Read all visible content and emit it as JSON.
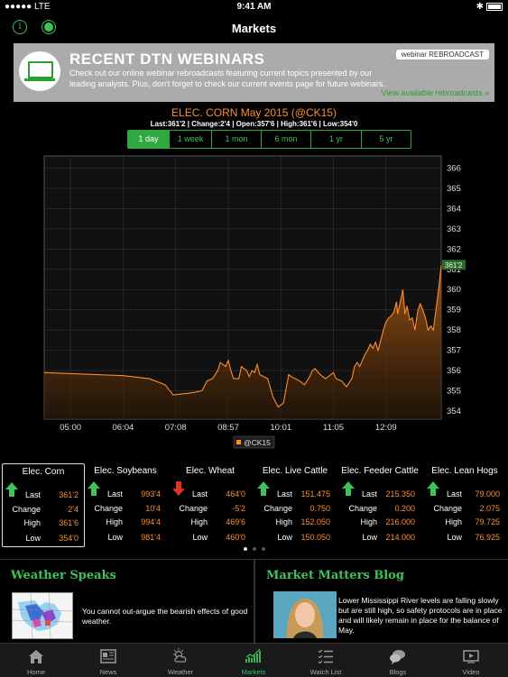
{
  "status_bar": {
    "signal": "●●●●● LTE",
    "time": "9:41 AM",
    "bluetooth": "✱"
  },
  "nav": {
    "title": "Markets"
  },
  "banner": {
    "heading": "RECENT DTN WEBINARS",
    "tag": "webinar REBROADCAST",
    "desc": "Check out our online webinar rebroadcasts featuring current topics presented by our leading analysts. Plus, don't forget to check our current events page for future webinars.",
    "link": "View available rebroadcasts »",
    "colors": {
      "background": "#ababab",
      "accent": "#2aa02e"
    }
  },
  "chart_header": {
    "title": "ELEC. CORN May 2015 (@CK15)",
    "stats": "Last:361'2 | Change:2'4 | Open:357'6 | High:361'6 | Low:354'0"
  },
  "ranges": [
    "1 day",
    "1 week",
    "1 mon",
    "6 mon",
    "1 yr",
    "5 yr"
  ],
  "active_range": "1 day",
  "chart_data": {
    "type": "area",
    "x_ticks": [
      "05:00",
      "06:04",
      "07:08",
      "08:57",
      "10:01",
      "11:05",
      "12:09"
    ],
    "y_ticks": [
      "354",
      "355",
      "356",
      "357",
      "358",
      "359",
      "360",
      "361",
      "362",
      "363",
      "364",
      "365",
      "366"
    ],
    "ylim": [
      353.6,
      366.6
    ],
    "legend": "@CK15",
    "last_label": "361'2",
    "series": [
      {
        "name": "@CK15",
        "color": "#ff8c2a",
        "points": [
          [
            0.0,
            355.9
          ],
          [
            0.5,
            355.85
          ],
          [
            1.0,
            355.8
          ],
          [
            1.5,
            355.75
          ],
          [
            2.0,
            355.6
          ],
          [
            2.3,
            355.3
          ],
          [
            2.45,
            354.8
          ],
          [
            2.8,
            354.9
          ],
          [
            3.0,
            355.0
          ],
          [
            3.1,
            355.5
          ],
          [
            3.2,
            355.6
          ],
          [
            3.3,
            356.0
          ],
          [
            3.35,
            356.4
          ],
          [
            3.45,
            356.2
          ],
          [
            3.5,
            356.5
          ],
          [
            3.55,
            356.0
          ],
          [
            3.6,
            355.6
          ],
          [
            3.7,
            355.6
          ],
          [
            3.75,
            356.2
          ],
          [
            3.85,
            356.0
          ],
          [
            3.9,
            355.7
          ],
          [
            3.95,
            356.0
          ],
          [
            4.0,
            355.9
          ],
          [
            4.05,
            356.3
          ],
          [
            4.1,
            355.8
          ],
          [
            4.25,
            355.6
          ],
          [
            4.35,
            354.7
          ],
          [
            4.45,
            354.2
          ],
          [
            4.5,
            354.3
          ],
          [
            4.55,
            354.4
          ],
          [
            4.6,
            355.1
          ],
          [
            4.65,
            355.8
          ],
          [
            4.7,
            355.7
          ],
          [
            4.85,
            355.5
          ],
          [
            4.95,
            355.3
          ],
          [
            5.05,
            355.7
          ],
          [
            5.1,
            356.0
          ],
          [
            5.15,
            356.1
          ],
          [
            5.25,
            355.8
          ],
          [
            5.35,
            355.6
          ],
          [
            5.5,
            355.9
          ],
          [
            5.55,
            355.6
          ],
          [
            5.65,
            355.5
          ],
          [
            5.75,
            355.2
          ],
          [
            5.8,
            355.4
          ],
          [
            5.85,
            355.6
          ],
          [
            5.9,
            356.2
          ],
          [
            5.95,
            356.4
          ],
          [
            6.0,
            356.2
          ],
          [
            6.1,
            356.8
          ],
          [
            6.15,
            357.0
          ],
          [
            6.2,
            357.3
          ],
          [
            6.25,
            357.1
          ],
          [
            6.3,
            357.4
          ],
          [
            6.35,
            357.0
          ],
          [
            6.4,
            357.5
          ],
          [
            6.45,
            358.0
          ],
          [
            6.5,
            358.4
          ],
          [
            6.55,
            358.6
          ],
          [
            6.6,
            358.7
          ],
          [
            6.65,
            358.9
          ],
          [
            6.7,
            359.4
          ],
          [
            6.72,
            358.8
          ],
          [
            6.78,
            359.5
          ],
          [
            6.82,
            360.0
          ],
          [
            6.86,
            358.8
          ],
          [
            6.9,
            359.2
          ],
          [
            6.95,
            358.5
          ],
          [
            7.0,
            358.6
          ],
          [
            7.05,
            358.0
          ],
          [
            7.1,
            358.9
          ],
          [
            7.15,
            359.3
          ],
          [
            7.2,
            359.0
          ],
          [
            7.25,
            358.6
          ],
          [
            7.3,
            358.0
          ],
          [
            7.35,
            358.2
          ],
          [
            7.4,
            358.0
          ],
          [
            7.45,
            359.0
          ],
          [
            7.5,
            360.0
          ],
          [
            7.55,
            361.2
          ]
        ],
        "x_tick_index": [
          0.5,
          1.5,
          2.5,
          3.5,
          4.5,
          5.5,
          6.5
        ]
      }
    ]
  },
  "quotes": [
    {
      "name": "Elec. Corn",
      "dir": "up",
      "last": "361'2",
      "change": "2'4",
      "high": "361'6",
      "low": "354'0",
      "selected": true
    },
    {
      "name": "Elec. Soybeans",
      "dir": "up",
      "last": "993'4",
      "change": "10'4",
      "high": "994'4",
      "low": "981'4",
      "selected": false
    },
    {
      "name": "Elec. Wheat",
      "dir": "down",
      "last": "464'0",
      "change": "-5'2",
      "high": "469'6",
      "low": "460'0",
      "selected": false
    },
    {
      "name": "Elec. Live Cattle",
      "dir": "up",
      "last": "151.475",
      "change": "0.750",
      "high": "152.050",
      "low": "150.050",
      "selected": false
    },
    {
      "name": "Elec. Feeder Cattle",
      "dir": "up",
      "last": "215.350",
      "change": "0.200",
      "high": "216.000",
      "low": "214.000",
      "selected": false
    },
    {
      "name": "Elec. Lean Hogs",
      "dir": "up",
      "last": "79.000",
      "change": "2.075",
      "high": "79.725",
      "low": "76.925",
      "selected": false
    }
  ],
  "quote_labels": {
    "last": "Last",
    "change": "Change",
    "high": "High",
    "low": "Low"
  },
  "weather": {
    "title": "Weather Speaks",
    "text": "You cannot out-argue the bearish effects of good weather."
  },
  "blog": {
    "title": "Market Matters Blog",
    "text": "Lower Mississippi River levels are falling slowly but are still high, so safety protocols are in place and will likely remain in place for the balance of May."
  },
  "tabs": [
    {
      "label": "Home",
      "icon": "home-icon"
    },
    {
      "label": "News",
      "icon": "news-icon"
    },
    {
      "label": "Weather",
      "icon": "weather-icon"
    },
    {
      "label": "Markets",
      "icon": "markets-icon",
      "active": true
    },
    {
      "label": "Watch List",
      "icon": "watch-list-icon"
    },
    {
      "label": "Blogs",
      "icon": "blogs-icon"
    },
    {
      "label": "Video",
      "icon": "video-icon"
    }
  ],
  "colors": {
    "accent": "#3ec35a",
    "value": "#ff8c2a",
    "up": "#3ec35a",
    "down": "#e0322a"
  }
}
